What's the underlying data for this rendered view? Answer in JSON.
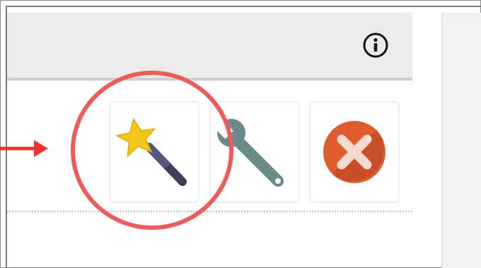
{
  "header": {
    "info_icon": "info-icon"
  },
  "toolbar": {
    "tools": [
      {
        "icon": "magic-wand-icon"
      },
      {
        "icon": "wrench-icon"
      },
      {
        "icon": "delete-icon"
      }
    ]
  },
  "annotation": {
    "highlight_color": "#ef5a5a",
    "arrow_color": "#e8362e"
  },
  "colors": {
    "star": "#f5c518",
    "wand_handle": "#3d3f5c",
    "wrench": "#6b8a8c",
    "delete_circle": "#e05b2e",
    "delete_x": "#f3dccf"
  }
}
